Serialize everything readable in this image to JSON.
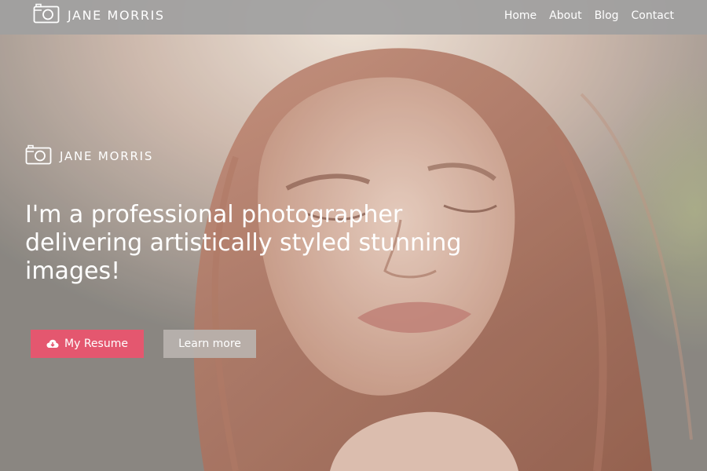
{
  "navbar": {
    "brand_icon": "camera-icon",
    "brand_name": "JANE MORRIS",
    "links": [
      "Home",
      "About",
      "Blog",
      "Contact"
    ]
  },
  "hero": {
    "brand_icon": "camera-icon",
    "brand_name": "JANE MORRIS",
    "headline": "I'm a professional photographer delivering artistically styled stunning images!",
    "resume_button": {
      "label": "My Resume",
      "icon": "cloud-download-icon"
    },
    "learn_more_button": {
      "label": "Learn more"
    }
  },
  "colors": {
    "accent": "#e4576f",
    "navbar_bg": "#a0a0a0",
    "text": "#ffffff"
  }
}
